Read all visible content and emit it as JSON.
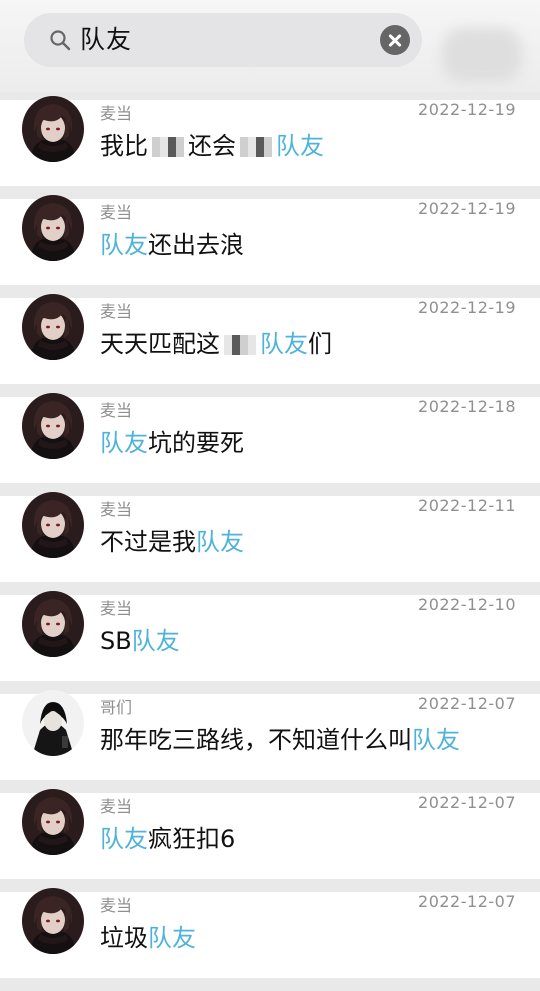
{
  "search": {
    "query": "队友"
  },
  "results": [
    {
      "name": "麦当",
      "date": "2022-12-19",
      "avatar": "anime-girl-dark",
      "segments": [
        {
          "t": "我比",
          "hl": false
        },
        {
          "t": "",
          "censor": true
        },
        {
          "t": "还会",
          "hl": false
        },
        {
          "t": "",
          "censor": true
        },
        {
          "t": "队友",
          "hl": true
        }
      ]
    },
    {
      "name": "麦当",
      "date": "2022-12-19",
      "avatar": "anime-girl-dark",
      "segments": [
        {
          "t": "队友",
          "hl": true
        },
        {
          "t": "还出去浪",
          "hl": false
        }
      ]
    },
    {
      "name": "麦当",
      "date": "2022-12-19",
      "avatar": "anime-girl-dark",
      "segments": [
        {
          "t": "天天匹配这",
          "hl": false
        },
        {
          "t": "",
          "censor": true
        },
        {
          "t": "队友",
          "hl": true
        },
        {
          "t": "们",
          "hl": false
        }
      ]
    },
    {
      "name": "麦当",
      "date": "2022-12-18",
      "avatar": "anime-girl-dark",
      "segments": [
        {
          "t": "队友",
          "hl": true
        },
        {
          "t": "坑的要死",
          "hl": false
        }
      ]
    },
    {
      "name": "麦当",
      "date": "2022-12-11",
      "avatar": "anime-girl-dark",
      "segments": [
        {
          "t": "不过是我",
          "hl": false
        },
        {
          "t": "队友",
          "hl": true
        }
      ]
    },
    {
      "name": "麦当",
      "date": "2022-12-10",
      "avatar": "anime-girl-dark",
      "segments": [
        {
          "t": "SB",
          "hl": false
        },
        {
          "t": "队友",
          "hl": true
        }
      ]
    },
    {
      "name": "哥们",
      "date": "2022-12-07",
      "avatar": "dark-hooded-figure",
      "segments": [
        {
          "t": "那年吃三路线，不知道什么叫",
          "hl": false
        },
        {
          "t": "队友",
          "hl": true
        }
      ]
    },
    {
      "name": "麦当",
      "date": "2022-12-07",
      "avatar": "anime-girl-dark",
      "segments": [
        {
          "t": "队友",
          "hl": true
        },
        {
          "t": "疯狂扣6",
          "hl": false
        }
      ]
    },
    {
      "name": "麦当",
      "date": "2022-12-07",
      "avatar": "anime-girl-dark",
      "segments": [
        {
          "t": "垃圾",
          "hl": false
        },
        {
          "t": "队友",
          "hl": true
        }
      ]
    }
  ],
  "colors": {
    "highlight": "#4fb3d9",
    "meta": "#8f8f8f"
  }
}
